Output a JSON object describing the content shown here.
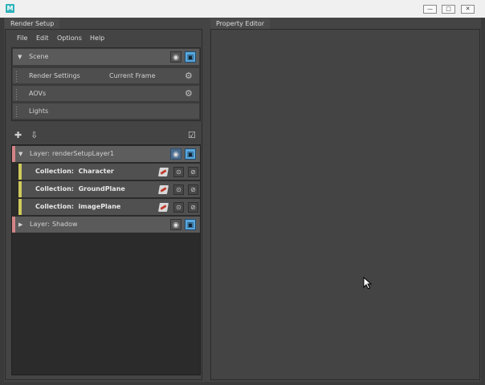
{
  "window": {
    "logo_letter": "M",
    "minimize_glyph": "—",
    "maximize_glyph": "□",
    "close_glyph": "✕"
  },
  "tabs": {
    "left": "Render Setup",
    "right": "Property Editor"
  },
  "menu": [
    "File",
    "Edit",
    "Options",
    "Help"
  ],
  "scene": {
    "label": "Scene",
    "items": [
      {
        "label": "Render Settings",
        "value": "Current Frame",
        "icon": "gear-icon"
      },
      {
        "label": "AOVs",
        "value": "",
        "icon": "gear-icon"
      },
      {
        "label": "Lights",
        "value": ""
      }
    ]
  },
  "toolbar": {
    "add_layer_icon": "add-layer-icon",
    "import_icon": "import-icon",
    "checklist_icon": "checklist-icon"
  },
  "layers": [
    {
      "prefix": "Layer:",
      "name": "renderSetupLayer1",
      "expanded": true,
      "visible_active": true,
      "collections": [
        {
          "prefix": "Collection:",
          "name": "Character"
        },
        {
          "prefix": "Collection:",
          "name": "GroundPlane"
        },
        {
          "prefix": "Collection:",
          "name": "imagePlane"
        }
      ]
    },
    {
      "prefix": "Layer:",
      "name": "Shadow",
      "expanded": false,
      "visible_active": false,
      "collections": []
    }
  ],
  "colors": {
    "layer_stripe": "#d48486",
    "collection_stripe": "#cfc95b",
    "render_button": "#58a8df",
    "logo": "#2fb1b9"
  }
}
